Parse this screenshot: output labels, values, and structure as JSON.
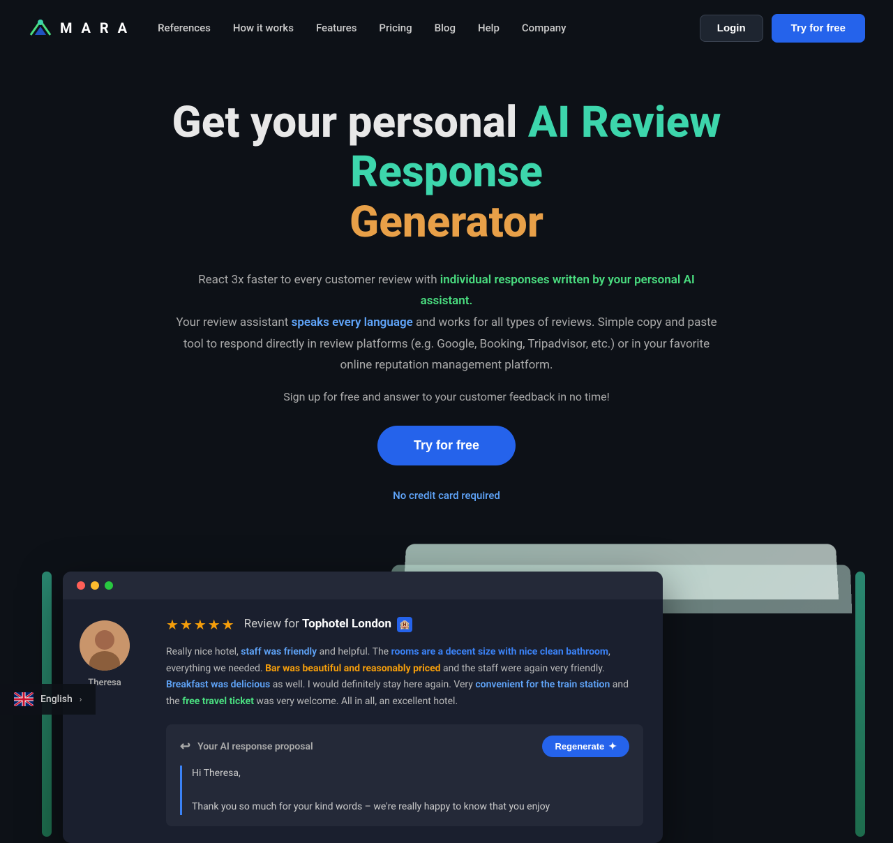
{
  "nav": {
    "logo_text": "M A R A",
    "links": [
      {
        "label": "References",
        "id": "references"
      },
      {
        "label": "How it works",
        "id": "how-it-works"
      },
      {
        "label": "Features",
        "id": "features"
      },
      {
        "label": "Pricing",
        "id": "pricing"
      },
      {
        "label": "Blog",
        "id": "blog"
      },
      {
        "label": "Help",
        "id": "help"
      },
      {
        "label": "Company",
        "id": "company"
      }
    ],
    "login_label": "Login",
    "try_free_label": "Try for free"
  },
  "hero": {
    "title_start": "Get your personal ",
    "title_ai": "AI Review Response",
    "title_generator": "Generator",
    "subtitle_1": "React 3x faster to every customer review with ",
    "subtitle_highlight_1": "individual responses written by your personal AI assistant.",
    "subtitle_2": "Your review assistant ",
    "subtitle_highlight_2": "speaks every language",
    "subtitle_3": " and works for all types of reviews. Simple copy and paste tool to respond directly in review platforms (e.g. Google, Booking, Tripadvisor, etc.) or in your favorite online reputation management platform.",
    "signup_text": "Sign up for free and answer to your customer feedback in no time!",
    "try_free_label": "Try for free",
    "no_cc_label": "No credit card required"
  },
  "demo": {
    "avatar_name": "Theresa",
    "review_hotel": "Tophotel London",
    "review_stars": "★★★★★",
    "review_for_text": "Review for",
    "review_text_1": "Really nice hotel, ",
    "review_hl_1": "staff was friendly",
    "review_text_2": " and helpful. The ",
    "review_hl_2": "rooms are a decent size with nice clean bathroom",
    "review_text_3": ", everything we needed. ",
    "review_hl_3": "Bar was beautiful and reasonably priced",
    "review_text_4": " and the staff were again very friendly. ",
    "review_hl_4": "Breakfast was delicious",
    "review_text_5": " as well. I would definitely stay here again. Very ",
    "review_hl_5": "convenient for the train station",
    "review_text_6": " and the ",
    "review_hl_6": "free travel ticket",
    "review_text_7": " was very welcome. All in all, an excellent hotel.",
    "ai_response_title": "Your AI response proposal",
    "regenerate_label": "Regenerate",
    "ai_response_text_1": "Hi Theresa,",
    "ai_response_text_2": "Thank you so much for your kind words – we're really happy to know that you enjoy"
  },
  "language": {
    "lang_label": "English",
    "lang_arrow": "›"
  }
}
